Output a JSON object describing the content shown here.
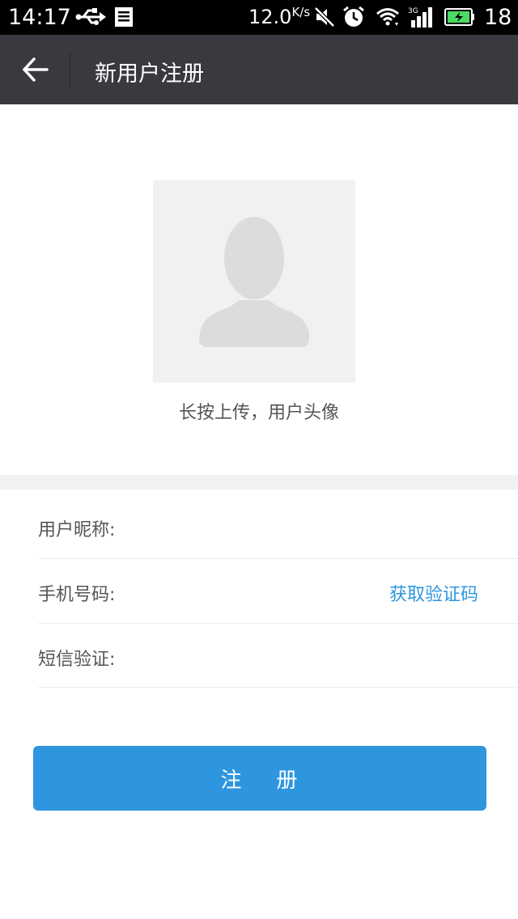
{
  "status_bar": {
    "time": "14:17",
    "net_speed": "12.0",
    "net_speed_unit": "K/s",
    "battery_level": "18",
    "icons": [
      "usb-icon",
      "document-icon",
      "mute-icon",
      "alarm-icon",
      "wifi-icon",
      "3g-signal-icon",
      "battery-charging-icon"
    ]
  },
  "app_bar": {
    "title": "新用户注册",
    "back_icon": "arrow-left-icon"
  },
  "avatar": {
    "icon": "user-silhouette-icon",
    "caption": "长按上传，用户头像"
  },
  "form": {
    "nickname_label": "用户昵称:",
    "nickname_value": "",
    "phone_label": "手机号码:",
    "phone_value": "",
    "get_code_label": "获取验证码",
    "sms_label": "短信验证:",
    "sms_value": ""
  },
  "register_button": {
    "label": "注    册"
  },
  "colors": {
    "status_bar_bg": "#000000",
    "app_bar_bg": "#393a3f",
    "accent": "#2e96df",
    "avatar_bg": "#f1f1f1",
    "silhouette": "#dcdcdc",
    "battery_fill": "#4cd964"
  }
}
